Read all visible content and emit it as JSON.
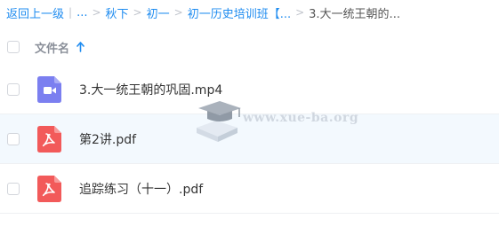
{
  "breadcrumb": {
    "back_label": "返回上一级",
    "ellipsis_label": "...",
    "items": [
      "秋下",
      "初一",
      "初一历史培训班【...",
      "3.大一统王朝的..."
    ]
  },
  "table": {
    "header": {
      "column_name": "文件名"
    },
    "rows": [
      {
        "name": "3.大一统王朝的巩固.mp4",
        "icon": "video-file-icon",
        "icon_color": "#7b7ff0"
      },
      {
        "name": "第2讲.pdf",
        "icon": "pdf-file-icon",
        "icon_color": "#f25a5a"
      },
      {
        "name": "追踪练习（十一）.pdf",
        "icon": "pdf-file-icon",
        "icon_color": "#f25a5a"
      }
    ]
  },
  "watermark": {
    "text": "www.xue-ba.org"
  },
  "colors": {
    "link": "#1f8cf0",
    "hover_row": "#f3f9fe"
  }
}
